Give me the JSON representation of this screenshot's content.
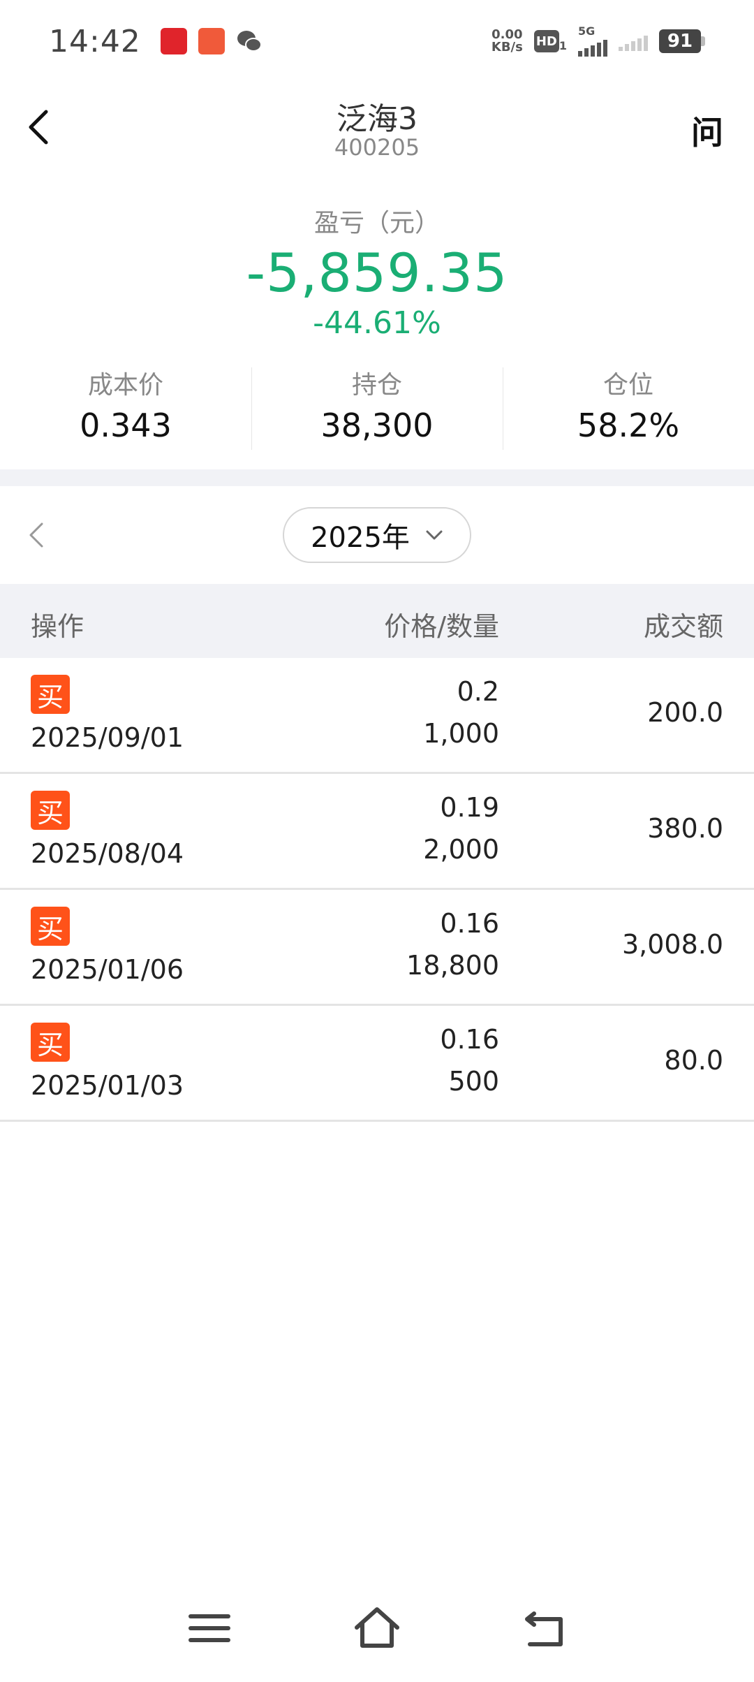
{
  "status": {
    "time": "14:42",
    "net_speed_value": "0.00",
    "net_speed_unit": "KB/s",
    "hd_label": "HD",
    "hd_sub": "1",
    "network": "5G",
    "battery": "91"
  },
  "header": {
    "title": "泛海3",
    "code": "400205",
    "ask_label": "问"
  },
  "pnl": {
    "label": "盈亏（元）",
    "value": "-5,859.35",
    "percent": "-44.61%"
  },
  "stats": [
    {
      "label": "成本价",
      "value": "0.343"
    },
    {
      "label": "持仓",
      "value": "38,300"
    },
    {
      "label": "仓位",
      "value": "58.2%"
    }
  ],
  "year_selector": {
    "year": "2025年"
  },
  "table": {
    "headers": {
      "operation": "操作",
      "price_qty": "价格/数量",
      "amount": "成交额"
    },
    "rows": [
      {
        "tag": "买",
        "date": "2025/09/01",
        "price": "0.2",
        "qty": "1,000",
        "amount": "200.0"
      },
      {
        "tag": "买",
        "date": "2025/08/04",
        "price": "0.19",
        "qty": "2,000",
        "amount": "380.0"
      },
      {
        "tag": "买",
        "date": "2025/01/06",
        "price": "0.16",
        "qty": "18,800",
        "amount": "3,008.0"
      },
      {
        "tag": "买",
        "date": "2025/01/03",
        "price": "0.16",
        "qty": "500",
        "amount": "80.0"
      }
    ]
  },
  "colors": {
    "loss_green": "#1aae74",
    "buy_tag": "#ff5219",
    "band": "#f1f2f6"
  },
  "icons": {
    "back": "chevron-left-icon",
    "year_prev": "chevron-left-icon",
    "year_dropdown": "chevron-down-icon",
    "nav_menu": "menu-icon",
    "nav_home": "home-icon",
    "nav_back": "return-icon"
  }
}
